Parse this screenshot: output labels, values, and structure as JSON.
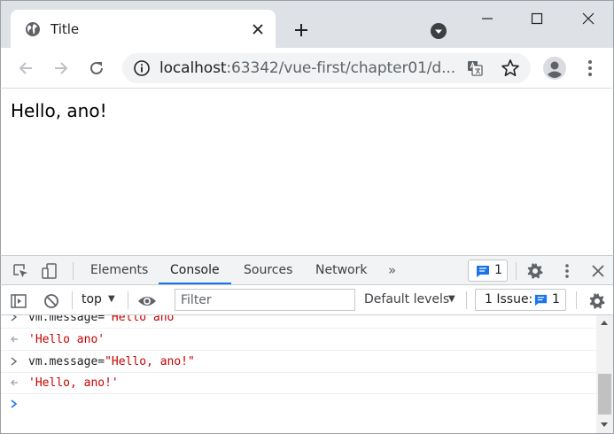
{
  "browser": {
    "tab_title": "Title",
    "url_host": "localhost",
    "url_rest": ":63342/vue-first/chapter01/d..."
  },
  "page": {
    "text": "Hello, ano!"
  },
  "devtools": {
    "tabs": [
      "Elements",
      "Console",
      "Sources",
      "Network"
    ],
    "active_tab": "Console",
    "more_tabs": "»",
    "message_count": "1",
    "context": "top",
    "filter_placeholder": "Filter",
    "levels_label": "Default levels",
    "issues_label": "1 Issue:",
    "issues_count": "1"
  },
  "console": {
    "lines": [
      {
        "kind": "input",
        "code": "vm.message=",
        "str": "\"Hello ano\""
      },
      {
        "kind": "output",
        "code": "",
        "str": "'Hello ano'"
      },
      {
        "kind": "input",
        "code": "vm.message=",
        "str": "\"Hello, ano!\""
      },
      {
        "kind": "output",
        "code": "",
        "str": "'Hello, ano!'"
      }
    ]
  },
  "colors": {
    "accent": "#1a73e8",
    "string": "#c80000",
    "chrome_bg": "#dee1e6"
  }
}
